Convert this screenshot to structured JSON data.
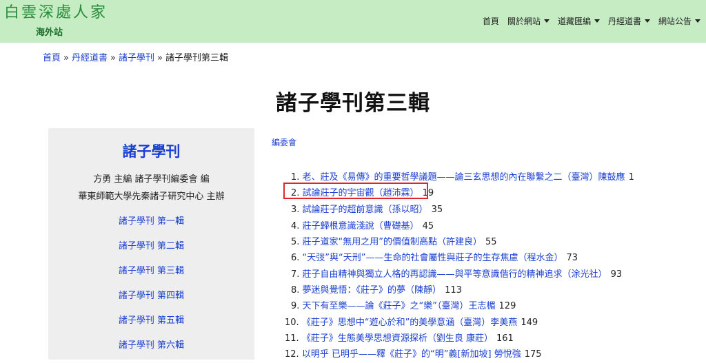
{
  "header": {
    "logo_text": "白雲深處人家",
    "logo_sub": "海外站",
    "nav": [
      {
        "label": "首頁",
        "has_menu": false
      },
      {
        "label": "關於網站",
        "has_menu": true
      },
      {
        "label": "道藏匯編",
        "has_menu": true
      },
      {
        "label": "丹經道書",
        "has_menu": true
      },
      {
        "label": "網站公告",
        "has_menu": true
      }
    ]
  },
  "breadcrumb": {
    "items": [
      "首頁",
      "丹經道書",
      "諸子學刊"
    ],
    "separator": "»",
    "current": "諸子學刊第三輯"
  },
  "page_title": "諸子學刊第三輯",
  "sidebar": {
    "title": "諸子學刊",
    "line1": "方勇 主編 諸子學刊編委會 編",
    "line2": "華東師範大學先秦諸子研究中心 主辦",
    "links": [
      "諸子學刊 第一輯",
      "諸子學刊 第二輯",
      "諸子學刊 第三輯",
      "諸子學刊 第四輯",
      "諸子學刊 第五輯",
      "諸子學刊 第六輯"
    ]
  },
  "main": {
    "committee": "編委會",
    "articles": [
      {
        "num": "1.",
        "title": "老、莊及《易傳》的重要哲學議題——論三玄思想的內在聯繫之二（臺灣）陳鼓應",
        "page": "1"
      },
      {
        "num": "2.",
        "title": "試論莊子的宇宙觀（趙沛霖）",
        "page": "19"
      },
      {
        "num": "3.",
        "title": "試論莊子的超前意識（孫以昭）",
        "page": "35"
      },
      {
        "num": "4.",
        "title": "莊子歸根意識淺說（曹礎基）",
        "page": "45"
      },
      {
        "num": "5.",
        "title": "莊子道家“無用之用”的價值制高點（許建良）",
        "page": "55"
      },
      {
        "num": "6.",
        "title": "“天弢”與“天刑”——生命的社會屬性與莊子的生存焦慮（程水金）",
        "page": "73"
      },
      {
        "num": "7.",
        "title": "莊子自由精神與獨立人格的再認識——與平等意識偕行的精神追求（涂光社）",
        "page": "93"
      },
      {
        "num": "8.",
        "title": "夢迷與覺悟：《莊子》的夢（陳靜）",
        "page": "113"
      },
      {
        "num": "9.",
        "title": "天下有至樂——論《莊子》之“樂”（臺灣）王志楣",
        "page": "129"
      },
      {
        "num": "10.",
        "title": "《莊子》思想中“遊心於和”的美學意涵（臺灣）李美燕",
        "page": "149"
      },
      {
        "num": "11.",
        "title": "《莊子》生態美學思想資源探析（劉生良 康莊）",
        "page": "161"
      },
      {
        "num": "12.",
        "title": "以明乎 已明乎——釋《莊子》的“明”義[新加坡] 勞悅強",
        "page": "175"
      }
    ]
  },
  "colors": {
    "header_bg": "#c6ecc3",
    "link": "#1a3fd1",
    "highlight": "#e0262a"
  }
}
